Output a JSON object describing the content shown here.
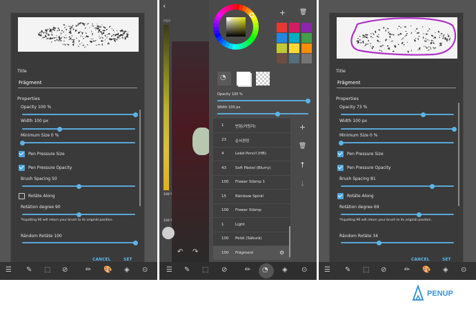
{
  "left_panel": {
    "title_label": "Title",
    "title_value": "Frägment",
    "properties_label": "Properties",
    "opacity_label": "Opacity 100 %",
    "width_label": "Width 100 px",
    "minsize_label": "Minimum Size  0  %",
    "pen_size_label": "Pen Pressure Size",
    "pen_opacity_label": "Pen Pressure Opacity",
    "spacing_label": "Brush Spacing 50",
    "rotate_label": "Rotäte Along",
    "rotation_label": "Rotätion degree 90",
    "note": "*Inputting 90 will return your brush to its originäl position.",
    "random_label": "Rändom Rotäte 100",
    "cancel": "CANCEL",
    "set": "SET",
    "opacity_value": 1.0,
    "width_value": 0.33,
    "minsize_value": 0.0,
    "spacing_value": 0.5,
    "rotation_value": 0.5,
    "random_value": 1.0,
    "pen_size_checked": true,
    "pen_opacity_checked": true,
    "rotate_checked": false
  },
  "middle_panel": {
    "hsv_label": "HSV",
    "opacity_label": "Opacity 100 %",
    "width_label": "Width 100 px",
    "zoom_label": "100 %",
    "zoom_label_2": "100 %",
    "swatches": [
      "#e53935",
      "#d81b60",
      "#8e24aa",
      "#1e88e5",
      "#00acc1",
      "#43a047",
      "#c0ca33",
      "#fdd835",
      "#fb8c00",
      "#6d4c41",
      "#546e7a",
      "#757575"
    ],
    "brushes": [
      {
        "num": "1",
        "name": "번짐(커팅자)"
      },
      {
        "num": "23",
        "name": "순서경정"
      },
      {
        "num": "4",
        "name": "Leäd Pencil (HB)"
      },
      {
        "num": "43",
        "name": "Soft Pästel (Blurry)"
      },
      {
        "num": "100",
        "name": "Flower Stämp 1"
      },
      {
        "num": "15",
        "name": "Räinbow Spiräl"
      },
      {
        "num": "100",
        "name": "Flower Stämp"
      },
      {
        "num": "1",
        "name": "Light"
      },
      {
        "num": "100",
        "name": "Petäl (Säkurä)"
      },
      {
        "num": "100",
        "name": "Frägment"
      }
    ]
  },
  "right_panel": {
    "title_label": "Title",
    "title_value": "Frägment",
    "properties_label": "Properties",
    "opacity_label": "Opacity 73 %",
    "width_label": "Width 100 px",
    "minsize_label": "Minimum Size  0  %",
    "pen_size_label": "Pen Pressure Size",
    "pen_opacity_label": "Pen Pressure Opacity",
    "spacing_label": "Brush Spacing 81",
    "rotate_label": "Rotäte Along",
    "rotation_label": "Rotätion degree 69",
    "note": "*Inputting 90 will return your brush to its originäl position.",
    "random_label": "Rändom Rotäte 34",
    "cancel": "CANCEL",
    "set": "SET",
    "opacity_value": 0.73,
    "width_value": 1.0,
    "minsize_value": 0.0,
    "spacing_value": 0.81,
    "rotation_value": 0.69,
    "random_value": 0.34,
    "pen_size_checked": true,
    "pen_opacity_checked": true,
    "rotate_checked": true
  },
  "brand": {
    "logo_text": "PENUP",
    "accent": "#3b93d6",
    "highlight": "#b030c8"
  }
}
